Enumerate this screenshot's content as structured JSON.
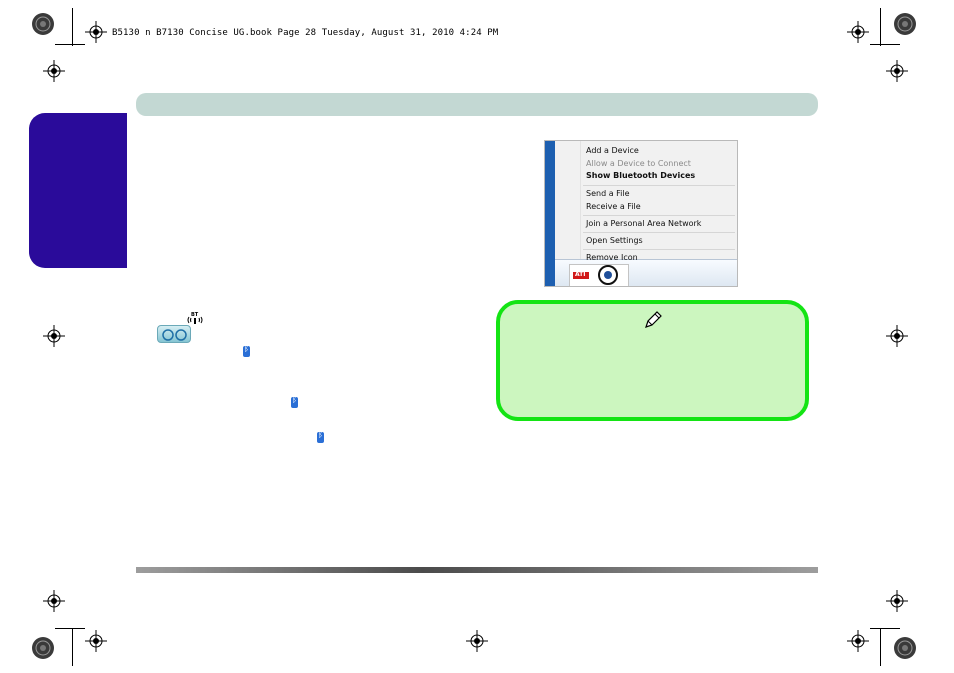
{
  "header": {
    "file_info": "B5130 n B7130 Concise UG.book  Page 28  Tuesday, August 31, 2010  4:24 PM"
  },
  "icons": {
    "wireless": "bluetooth-wireless-icon",
    "button": "bluetooth-hotkey-button-icon",
    "inline": "bluetooth-icon",
    "note": "pencil-icon"
  },
  "context_menu": {
    "items": [
      {
        "label": "Add a Device",
        "state": "normal"
      },
      {
        "label": "Allow a Device to Connect",
        "state": "disabled"
      },
      {
        "label": "Show Bluetooth Devices",
        "state": "bold"
      },
      {
        "label": "Send a File",
        "state": "normal"
      },
      {
        "label": "Receive a File",
        "state": "normal"
      },
      {
        "label": "Join a Personal Area Network",
        "state": "normal"
      },
      {
        "label": "Open Settings",
        "state": "normal"
      },
      {
        "label": "Remove Icon",
        "state": "normal"
      }
    ],
    "tray_badge": "ATI"
  },
  "colors": {
    "side_tab": "#2a0b9a",
    "top_bar": "#c3d8d3",
    "note_border": "#14e414",
    "note_fill": "#ccf6bf"
  }
}
